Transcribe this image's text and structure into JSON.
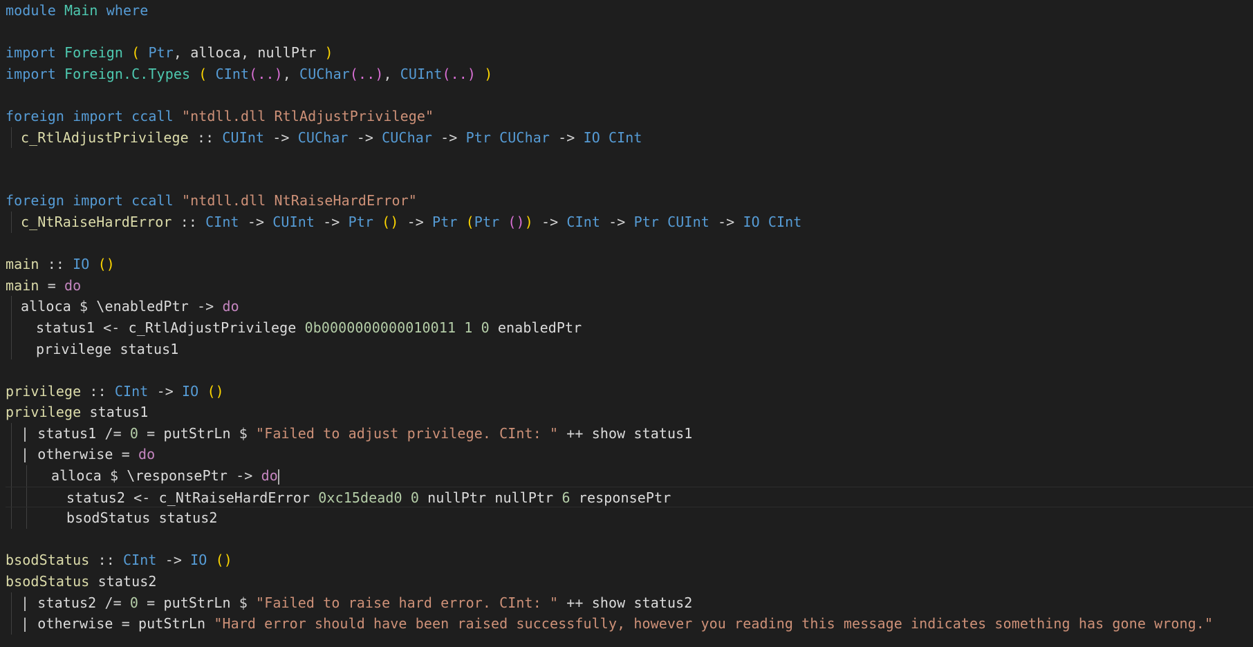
{
  "editor": {
    "language": "haskell",
    "theme": {
      "background": "#1e1e1e",
      "keyword": "#569cd6",
      "control": "#c586c0",
      "module": "#4ec9b0",
      "function": "#dcdcaa",
      "string": "#ce9178",
      "number": "#b5cea8",
      "paren_primary": "#ffd700",
      "paren_secondary": "#da70d6"
    },
    "cursor_line": 23,
    "lines": [
      {
        "indent": 0,
        "guides": [],
        "tokens": [
          [
            "kw",
            "module "
          ],
          [
            "mod",
            "Main"
          ],
          [
            "kw",
            " where"
          ]
        ]
      },
      {
        "indent": 0,
        "guides": [],
        "tokens": []
      },
      {
        "indent": 0,
        "guides": [],
        "tokens": [
          [
            "kw",
            "import "
          ],
          [
            "mod",
            "Foreign"
          ],
          [
            "plain",
            " "
          ],
          [
            "paren1",
            "("
          ],
          [
            "plain",
            " "
          ],
          [
            "type",
            "Ptr"
          ],
          [
            "plain",
            ", "
          ],
          [
            "var",
            "alloca"
          ],
          [
            "plain",
            ", "
          ],
          [
            "var",
            "nullPtr"
          ],
          [
            "plain",
            " "
          ],
          [
            "paren1",
            ")"
          ]
        ]
      },
      {
        "indent": 0,
        "guides": [],
        "tokens": [
          [
            "kw",
            "import "
          ],
          [
            "mod",
            "Foreign.C.Types"
          ],
          [
            "plain",
            " "
          ],
          [
            "paren1",
            "("
          ],
          [
            "plain",
            " "
          ],
          [
            "type",
            "CInt"
          ],
          [
            "paren2",
            "(..)"
          ],
          [
            "plain",
            ", "
          ],
          [
            "type",
            "CUChar"
          ],
          [
            "paren2",
            "(..)"
          ],
          [
            "plain",
            ", "
          ],
          [
            "type",
            "CUInt"
          ],
          [
            "paren2",
            "(..)"
          ],
          [
            "plain",
            " "
          ],
          [
            "paren1",
            ")"
          ]
        ]
      },
      {
        "indent": 0,
        "guides": [],
        "tokens": []
      },
      {
        "indent": 0,
        "guides": [],
        "tokens": [
          [
            "kw",
            "foreign import ccall "
          ],
          [
            "str",
            "\"ntdll.dll RtlAdjustPrivilege\""
          ]
        ]
      },
      {
        "indent": 1,
        "guides": [
          1
        ],
        "tokens": [
          [
            "func",
            "c_RtlAdjustPrivilege"
          ],
          [
            "op",
            " :: "
          ],
          [
            "type",
            "CUInt"
          ],
          [
            "op",
            " -> "
          ],
          [
            "type",
            "CUChar"
          ],
          [
            "op",
            " -> "
          ],
          [
            "type",
            "CUChar"
          ],
          [
            "op",
            " -> "
          ],
          [
            "type",
            "Ptr CUChar"
          ],
          [
            "op",
            " -> "
          ],
          [
            "type",
            "IO CInt"
          ]
        ]
      },
      {
        "indent": 0,
        "guides": [],
        "tokens": []
      },
      {
        "indent": 0,
        "guides": [],
        "tokens": []
      },
      {
        "indent": 0,
        "guides": [],
        "tokens": [
          [
            "kw",
            "foreign import ccall "
          ],
          [
            "str",
            "\"ntdll.dll NtRaiseHardError\""
          ]
        ]
      },
      {
        "indent": 1,
        "guides": [
          1
        ],
        "tokens": [
          [
            "func",
            "c_NtRaiseHardError"
          ],
          [
            "op",
            " :: "
          ],
          [
            "type",
            "CInt"
          ],
          [
            "op",
            " -> "
          ],
          [
            "type",
            "CUInt"
          ],
          [
            "op",
            " -> "
          ],
          [
            "type",
            "Ptr"
          ],
          [
            "plain",
            " "
          ],
          [
            "paren1",
            "()"
          ],
          [
            "op",
            " -> "
          ],
          [
            "type",
            "Ptr"
          ],
          [
            "plain",
            " "
          ],
          [
            "paren1",
            "("
          ],
          [
            "type",
            "Ptr"
          ],
          [
            "plain",
            " "
          ],
          [
            "paren2",
            "()"
          ],
          [
            "paren1",
            ")"
          ],
          [
            "op",
            " -> "
          ],
          [
            "type",
            "CInt"
          ],
          [
            "op",
            " -> "
          ],
          [
            "type",
            "Ptr CUInt"
          ],
          [
            "op",
            " -> "
          ],
          [
            "type",
            "IO CInt"
          ]
        ]
      },
      {
        "indent": 0,
        "guides": [],
        "tokens": []
      },
      {
        "indent": 0,
        "guides": [],
        "tokens": [
          [
            "func",
            "main"
          ],
          [
            "op",
            " :: "
          ],
          [
            "type",
            "IO"
          ],
          [
            "plain",
            " "
          ],
          [
            "paren1",
            "()"
          ]
        ]
      },
      {
        "indent": 0,
        "guides": [],
        "tokens": [
          [
            "func",
            "main"
          ],
          [
            "op",
            " = "
          ],
          [
            "ctl",
            "do"
          ]
        ]
      },
      {
        "indent": 1,
        "guides": [
          1
        ],
        "tokens": [
          [
            "var",
            "alloca"
          ],
          [
            "op",
            " $ "
          ],
          [
            "var",
            "\\enabledPtr"
          ],
          [
            "op",
            " -> "
          ],
          [
            "ctl",
            "do"
          ]
        ]
      },
      {
        "indent": 2,
        "guides": [
          1
        ],
        "tokens": [
          [
            "var",
            "status1"
          ],
          [
            "op",
            " <- "
          ],
          [
            "var",
            "c_RtlAdjustPrivilege"
          ],
          [
            "plain",
            " "
          ],
          [
            "num",
            "0b0000000000010011"
          ],
          [
            "plain",
            " "
          ],
          [
            "num",
            "1"
          ],
          [
            "plain",
            " "
          ],
          [
            "num",
            "0"
          ],
          [
            "plain",
            " "
          ],
          [
            "var",
            "enabledPtr"
          ]
        ]
      },
      {
        "indent": 2,
        "guides": [
          1
        ],
        "tokens": [
          [
            "var",
            "privilege"
          ],
          [
            "plain",
            " "
          ],
          [
            "var",
            "status1"
          ]
        ]
      },
      {
        "indent": 0,
        "guides": [],
        "tokens": []
      },
      {
        "indent": 0,
        "guides": [],
        "tokens": [
          [
            "func",
            "privilege"
          ],
          [
            "op",
            " :: "
          ],
          [
            "type",
            "CInt"
          ],
          [
            "op",
            " -> "
          ],
          [
            "type",
            "IO"
          ],
          [
            "plain",
            " "
          ],
          [
            "paren1",
            "()"
          ]
        ]
      },
      {
        "indent": 0,
        "guides": [],
        "tokens": [
          [
            "func",
            "privilege"
          ],
          [
            "plain",
            " "
          ],
          [
            "var",
            "status1"
          ]
        ]
      },
      {
        "indent": 1,
        "guides": [
          1
        ],
        "tokens": [
          [
            "op",
            "| "
          ],
          [
            "var",
            "status1"
          ],
          [
            "op",
            " /= "
          ],
          [
            "num",
            "0"
          ],
          [
            "op",
            " = "
          ],
          [
            "var",
            "putStrLn"
          ],
          [
            "op",
            " $ "
          ],
          [
            "str",
            "\"Failed to adjust privilege. CInt: \""
          ],
          [
            "op",
            " ++ "
          ],
          [
            "var",
            "show"
          ],
          [
            "plain",
            " "
          ],
          [
            "var",
            "status1"
          ]
        ]
      },
      {
        "indent": 1,
        "guides": [
          1
        ],
        "tokens": [
          [
            "op",
            "| "
          ],
          [
            "var",
            "otherwise"
          ],
          [
            "op",
            " = "
          ],
          [
            "ctl",
            "do"
          ]
        ]
      },
      {
        "indent": 3,
        "guides": [
          1,
          2
        ],
        "tokens": [
          [
            "var",
            "alloca"
          ],
          [
            "op",
            " $ "
          ],
          [
            "var",
            "\\responsePtr"
          ],
          [
            "op",
            " -> "
          ],
          [
            "ctl",
            "do"
          ],
          [
            "cursor",
            ""
          ]
        ]
      },
      {
        "indent": 4,
        "guides": [
          1,
          2
        ],
        "tokens": [
          [
            "var",
            "status2"
          ],
          [
            "op",
            " <- "
          ],
          [
            "var",
            "c_NtRaiseHardError"
          ],
          [
            "plain",
            " "
          ],
          [
            "num",
            "0xc15dead0"
          ],
          [
            "plain",
            " "
          ],
          [
            "num",
            "0"
          ],
          [
            "plain",
            " "
          ],
          [
            "var",
            "nullPtr"
          ],
          [
            "plain",
            " "
          ],
          [
            "var",
            "nullPtr"
          ],
          [
            "plain",
            " "
          ],
          [
            "num",
            "6"
          ],
          [
            "plain",
            " "
          ],
          [
            "var",
            "responsePtr"
          ]
        ]
      },
      {
        "indent": 4,
        "guides": [
          1,
          2
        ],
        "tokens": [
          [
            "var",
            "bsodStatus"
          ],
          [
            "plain",
            " "
          ],
          [
            "var",
            "status2"
          ]
        ]
      },
      {
        "indent": 0,
        "guides": [],
        "tokens": []
      },
      {
        "indent": 0,
        "guides": [],
        "tokens": [
          [
            "func",
            "bsodStatus"
          ],
          [
            "op",
            " :: "
          ],
          [
            "type",
            "CInt"
          ],
          [
            "op",
            " -> "
          ],
          [
            "type",
            "IO"
          ],
          [
            "plain",
            " "
          ],
          [
            "paren1",
            "()"
          ]
        ]
      },
      {
        "indent": 0,
        "guides": [],
        "tokens": [
          [
            "func",
            "bsodStatus"
          ],
          [
            "plain",
            " "
          ],
          [
            "var",
            "status2"
          ]
        ]
      },
      {
        "indent": 1,
        "guides": [
          1
        ],
        "tokens": [
          [
            "op",
            "| "
          ],
          [
            "var",
            "status2"
          ],
          [
            "op",
            " /= "
          ],
          [
            "num",
            "0"
          ],
          [
            "op",
            " = "
          ],
          [
            "var",
            "putStrLn"
          ],
          [
            "op",
            " $ "
          ],
          [
            "str",
            "\"Failed to raise hard error. CInt: \""
          ],
          [
            "op",
            " ++ "
          ],
          [
            "var",
            "show"
          ],
          [
            "plain",
            " "
          ],
          [
            "var",
            "status2"
          ]
        ]
      },
      {
        "indent": 1,
        "guides": [
          1
        ],
        "tokens": [
          [
            "op",
            "| "
          ],
          [
            "var",
            "otherwise"
          ],
          [
            "op",
            " = "
          ],
          [
            "var",
            "putStrLn"
          ],
          [
            "plain",
            " "
          ],
          [
            "str",
            "\"Hard error should have been raised successfully, however you reading this message indicates something has gone wrong.\""
          ]
        ]
      }
    ]
  }
}
